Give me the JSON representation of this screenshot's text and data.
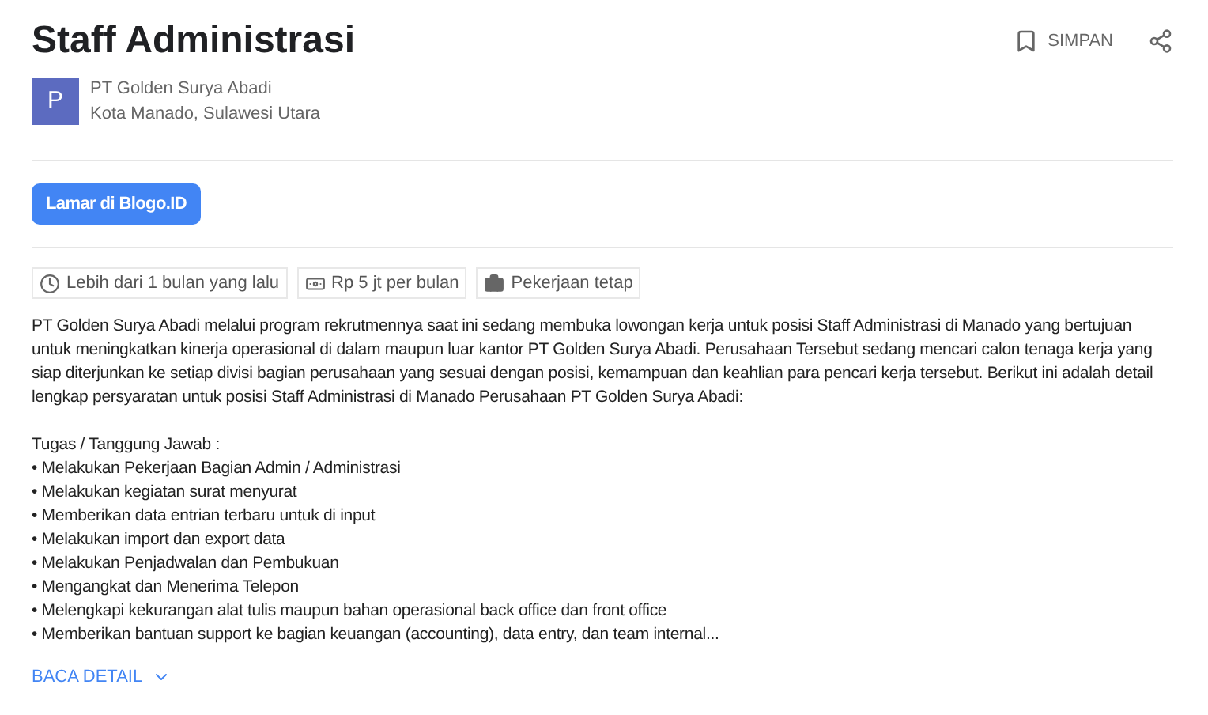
{
  "job": {
    "title": "Staff Administrasi",
    "company_initial": "P",
    "company": "PT Golden Surya Abadi",
    "location": "Kota Manado, Sulawesi Utara"
  },
  "actions": {
    "save": "SIMPAN"
  },
  "apply_button": "Lamar di Blogo.ID",
  "chips": [
    {
      "kind": "time",
      "label": "Lebih dari 1 bulan yang lalu"
    },
    {
      "kind": "salary",
      "label": "Rp 5 jt per bulan"
    },
    {
      "kind": "type",
      "label": "Pekerjaan tetap"
    }
  ],
  "description": "PT Golden Surya Abadi melalui program rekrutmennya saat ini sedang membuka lowongan kerja untuk posisi Staff Administrasi di Manado yang bertujuan untuk meningkatkan kinerja operasional di dalam maupun luar kantor PT Golden Surya Abadi. Perusahaan Tersebut sedang mencari calon tenaga kerja yang siap diterjunkan ke setiap divisi bagian perusahaan yang sesuai dengan posisi, kemampuan dan keahlian para pencari kerja tersebut. Berikut ini adalah detail lengkap persyaratan untuk posisi Staff Administrasi di Manado Perusahaan PT Golden Surya Abadi:",
  "duties_heading": "Tugas / Tanggung Jawab :",
  "duties": [
    "• Melakukan Pekerjaan Bagian Admin / Administrasi",
    "• Melakukan kegiatan surat menyurat",
    "• Memberikan data entrian terbaru untuk di input",
    "• Melakukan import dan export data",
    "• Melakukan Penjadwalan dan Pembukuan",
    "• Mengangkat dan Menerima Telepon",
    "• Melengkapi kekurangan alat tulis maupun bahan operasional back office dan front office",
    "• Memberikan bantuan support ke bagian keuangan (accounting), data entry, dan team internal..."
  ],
  "read_more": "BACA DETAIL"
}
